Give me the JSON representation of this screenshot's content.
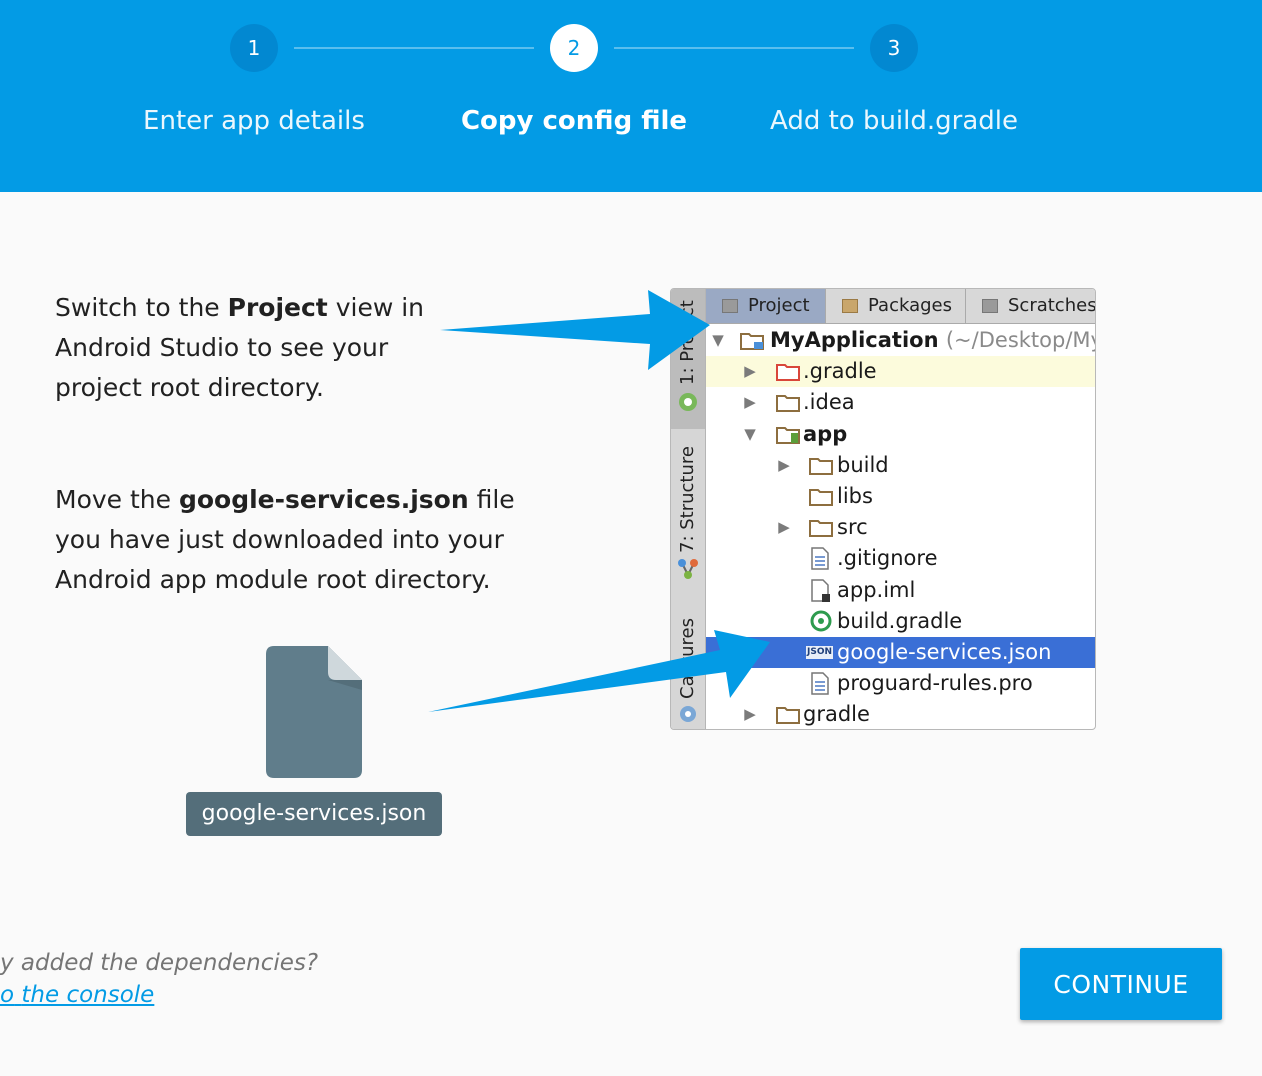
{
  "stepper": {
    "steps": [
      {
        "number": "1",
        "label": "Enter app details",
        "state": "done"
      },
      {
        "number": "2",
        "label": "Copy config file",
        "state": "active"
      },
      {
        "number": "3",
        "label": "Add to build.gradle",
        "state": "upcoming"
      }
    ]
  },
  "instructions": {
    "p1": {
      "before": "Switch to the ",
      "bold": "Project",
      "after": " view in Android Studio to see your project root directory."
    },
    "p2": {
      "before": "Move the ",
      "bold": "google-services.json",
      "after": " file you have just downloaded into your Android app module root directory."
    }
  },
  "file_chip": {
    "label": "google-services.json",
    "icon": "file-icon"
  },
  "android_studio": {
    "side_tabs": [
      "1: Project",
      "7: Structure",
      "Captures"
    ],
    "top_tabs": [
      {
        "label": "Project",
        "selected": true
      },
      {
        "label": "Packages",
        "selected": false
      },
      {
        "label": "Scratches",
        "selected": false
      }
    ],
    "tree": [
      {
        "label": "MyApplication",
        "suffix": "(~/Desktop/My",
        "icon": "module-folder-icon"
      },
      {
        "label": ".gradle",
        "icon": "folder-red-icon"
      },
      {
        "label": ".idea",
        "icon": "folder-icon"
      },
      {
        "label": "app",
        "icon": "android-module-icon"
      },
      {
        "label": "build",
        "icon": "folder-icon"
      },
      {
        "label": "libs",
        "icon": "folder-icon"
      },
      {
        "label": "src",
        "icon": "folder-icon"
      },
      {
        "label": ".gitignore",
        "icon": "text-file-icon"
      },
      {
        "label": "app.iml",
        "icon": "iml-file-icon"
      },
      {
        "label": "build.gradle",
        "icon": "gradle-file-icon"
      },
      {
        "label": "google-services.json",
        "icon": "json-file-icon"
      },
      {
        "label": "proguard-rules.pro",
        "icon": "text-file-icon"
      },
      {
        "label": "gradle",
        "icon": "folder-icon"
      }
    ],
    "json_badge": "JSON"
  },
  "footer": {
    "question": "y added the dependencies?",
    "link": "the console",
    "link_prefix": "o",
    "continue_label": "CONTINUE"
  },
  "colors": {
    "header": "#039be5",
    "accent": "#039be5",
    "chip": "#546e7a",
    "selection": "#3a6fd6"
  }
}
